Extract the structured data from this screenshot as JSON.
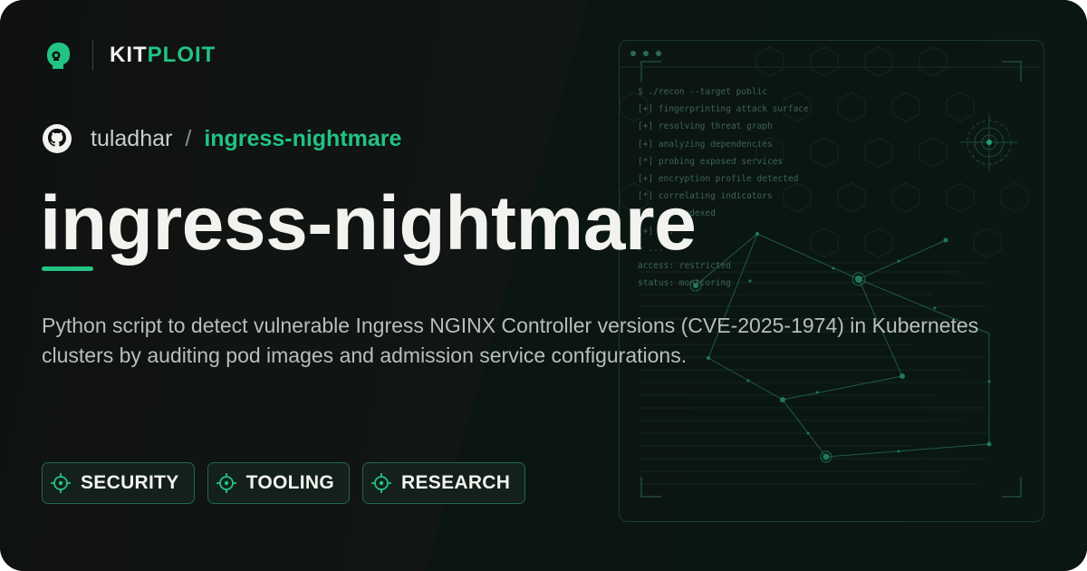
{
  "brand": {
    "kit": "KIT",
    "ploit": "PLOIT"
  },
  "repo": {
    "owner": "tuladhar",
    "separator": "/",
    "name": "ingress-nightmare"
  },
  "title": "ingress-nightmare",
  "description": "Python script to detect vulnerable Ingress NGINX Controller versions (CVE-2025-1974) in Kubernetes clusters by auditing pod images and admission service configurations.",
  "tags": [
    {
      "label": "SECURITY",
      "icon": "target-icon"
    },
    {
      "label": "TOOLING",
      "icon": "target-icon"
    },
    {
      "label": "RESEARCH",
      "icon": "target-icon"
    }
  ],
  "terminal": {
    "lines": [
      "$ ./recon --target public",
      "[+] fingerprinting attack surface",
      "[+] resolving threat graph",
      "[+] analyzing dependencies",
      "[*] probing exposed services",
      "[+] encryption profile detected",
      "[*] correlating indicators",
      "[+] ... indexed",
      "[+] ...",
      "> ...",
      "access: restricted",
      "status: monitoring"
    ]
  },
  "colors": {
    "accent": "#22c383",
    "text": "#f2f2ee",
    "muted": "#b8bebb",
    "background": "#0f1211"
  }
}
